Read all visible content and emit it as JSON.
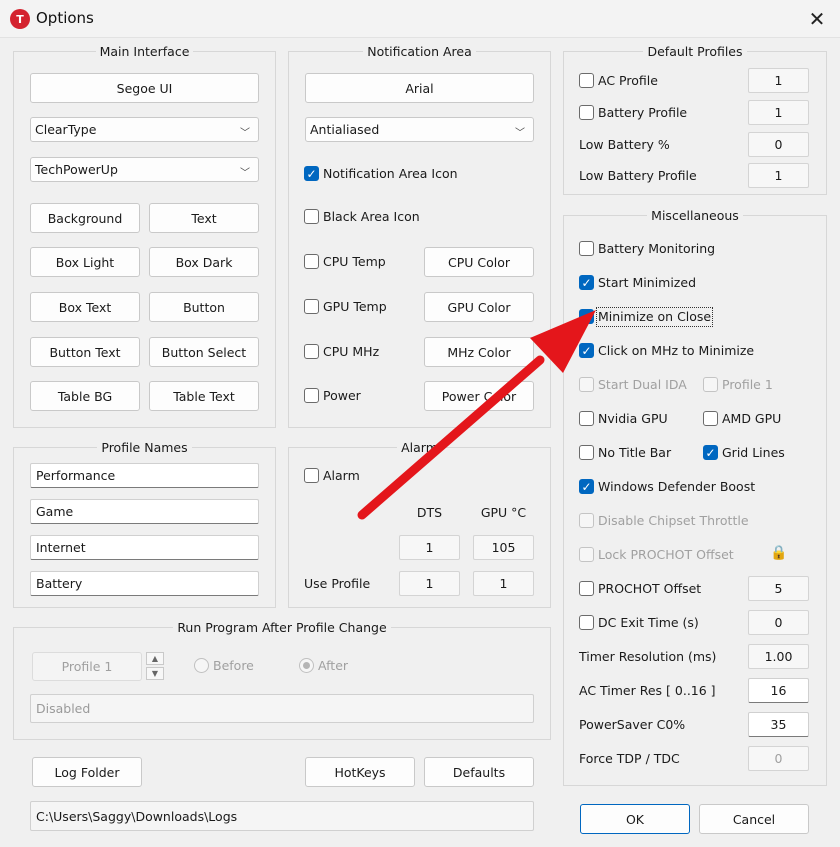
{
  "window": {
    "title": "Options",
    "app_icon": "T"
  },
  "main_interface": {
    "title": "Main Interface",
    "font_button": "Segoe UI",
    "render_mode": "ClearType",
    "skin": "TechPowerUp",
    "color_buttons": [
      "Background",
      "Text",
      "Box Light",
      "Box Dark",
      "Box Text",
      "Button",
      "Button Text",
      "Button Select",
      "Table BG",
      "Table Text"
    ]
  },
  "notification_area": {
    "title": "Notification Area",
    "font_button": "Arial",
    "render_mode": "Antialiased",
    "notification_icon": {
      "label": "Notification Area Icon",
      "checked": true
    },
    "black_icon": {
      "label": "Black Area Icon",
      "checked": false
    },
    "rows": [
      {
        "label": "CPU Temp",
        "button": "CPU Color"
      },
      {
        "label": "GPU Temp",
        "button": "GPU Color"
      },
      {
        "label": "CPU MHz",
        "button": "MHz Color"
      },
      {
        "label": "Power",
        "button": "Power Color"
      }
    ]
  },
  "default_profiles": {
    "title": "Default Profiles",
    "ac_profile": {
      "label": "AC Profile",
      "value": "1"
    },
    "battery_profile": {
      "label": "Battery Profile",
      "value": "1"
    },
    "low_battery_pct": {
      "label": "Low Battery %",
      "value": "0"
    },
    "low_battery_profile": {
      "label": "Low Battery Profile",
      "value": "1"
    }
  },
  "miscellaneous": {
    "title": "Miscellaneous",
    "battery_monitoring": "Battery Monitoring",
    "start_minimized": "Start Minimized",
    "minimize_on_close": "Minimize on Close",
    "click_mhz_minimize": "Click on MHz to Minimize",
    "start_dual_ida": "Start Dual IDA",
    "profile_1": "Profile 1",
    "nvidia_gpu": "Nvidia GPU",
    "amd_gpu": "AMD GPU",
    "no_title_bar": "No Title Bar",
    "grid_lines": "Grid Lines",
    "defender_boost": "Windows Defender Boost",
    "disable_chipset_throttle": "Disable Chipset Throttle",
    "lock_prochot": "Lock PROCHOT Offset",
    "prochot_offset": {
      "label": "PROCHOT Offset",
      "value": "5"
    },
    "dc_exit_time": {
      "label": "DC Exit Time (s)",
      "value": "0"
    },
    "timer_resolution": {
      "label": "Timer Resolution (ms)",
      "value": "1.00"
    },
    "ac_timer_res": {
      "label": "AC Timer Res [ 0..16 ]",
      "value": "16"
    },
    "powersaver_c0": {
      "label": "PowerSaver C0%",
      "value": "35"
    },
    "force_tdp": {
      "label": "Force TDP / TDC",
      "value": "0"
    }
  },
  "profile_names": {
    "title": "Profile Names",
    "names": [
      "Performance",
      "Game",
      "Internet",
      "Battery"
    ]
  },
  "alarm": {
    "title": "Alarm",
    "checkbox": "Alarm",
    "col_dts": "DTS",
    "col_gpu": "GPU °C",
    "dts_value": "1",
    "gpu_value": "105",
    "use_profile_label": "Use Profile",
    "use_profile_dts": "1",
    "use_profile_gpu": "1"
  },
  "run_program": {
    "title": "Run Program After Profile Change",
    "profile_button": "Profile 1",
    "before": "Before",
    "after": "After",
    "path": "Disabled"
  },
  "bottom": {
    "log_folder": "Log Folder",
    "hotkeys": "HotKeys",
    "defaults": "Defaults",
    "log_path": "C:\\Users\\Saggy\\Downloads\\Logs",
    "ok": "OK",
    "cancel": "Cancel"
  },
  "colors": {
    "accent": "#0067c0",
    "arrow": "#e4161b",
    "app_icon": "#d4232f"
  }
}
